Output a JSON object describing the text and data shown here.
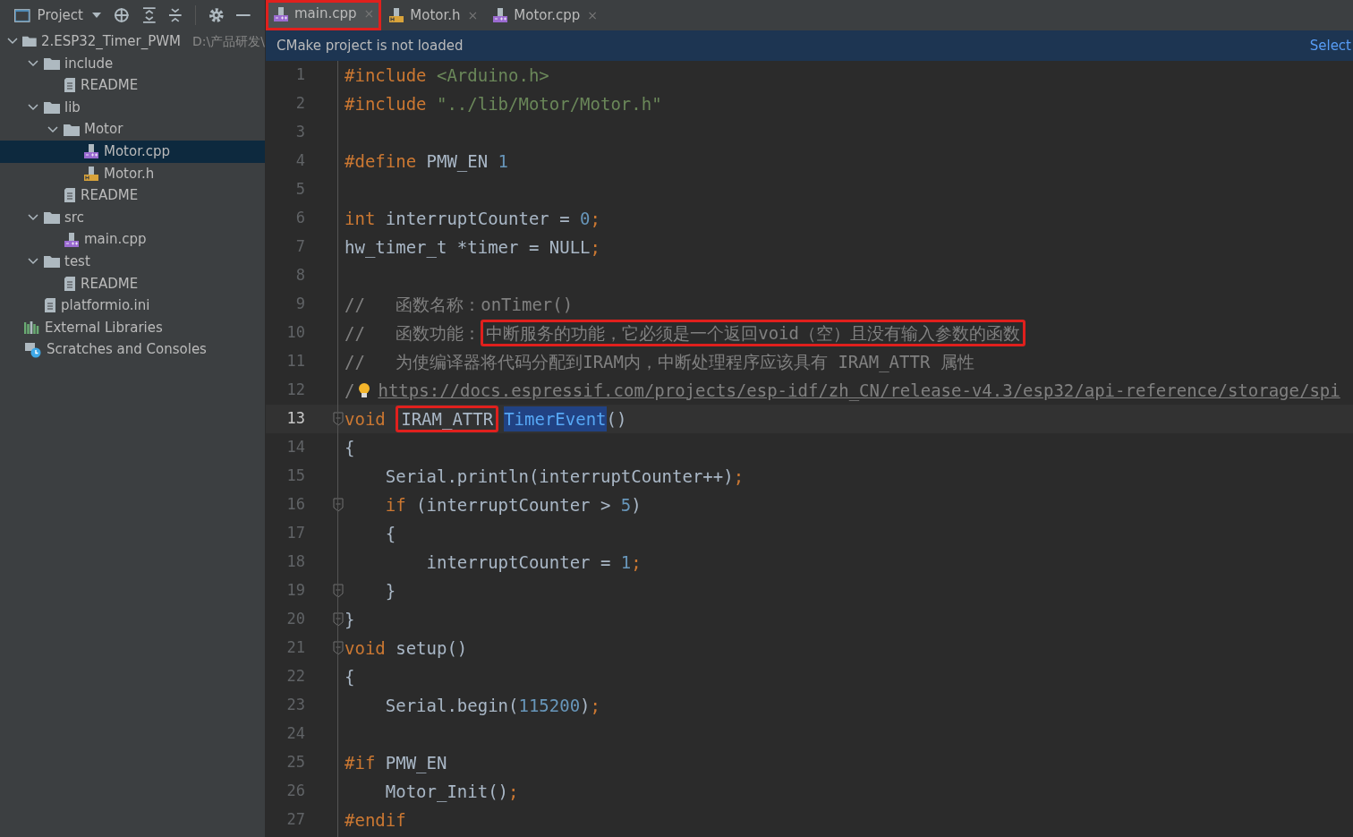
{
  "toolbar": {
    "title": "Project"
  },
  "tabs": [
    {
      "label": "main.cpp",
      "kind": "cpp",
      "selected": true,
      "boxed": true,
      "close": "×"
    },
    {
      "label": "Motor.h",
      "kind": "h",
      "selected": false,
      "boxed": false,
      "close": "×"
    },
    {
      "label": "Motor.cpp",
      "kind": "cpp",
      "selected": false,
      "boxed": false,
      "close": "×"
    }
  ],
  "banner": {
    "message": "CMake project is not loaded",
    "action": "Select"
  },
  "tree": [
    {
      "label": "2.ESP32_Timer_PWM",
      "path": "D:\\产品研发\\",
      "kind": "folder",
      "expanded": true,
      "selected": false,
      "children": [
        {
          "label": "include",
          "kind": "folder",
          "expanded": true,
          "selected": false,
          "children": [
            {
              "label": "README",
              "kind": "text",
              "selected": false
            }
          ]
        },
        {
          "label": "lib",
          "kind": "folder",
          "expanded": true,
          "selected": false,
          "children": [
            {
              "label": "Motor",
              "kind": "folder",
              "expanded": true,
              "selected": false,
              "children": [
                {
                  "label": "Motor.cpp",
                  "kind": "cpp",
                  "selected": true
                },
                {
                  "label": "Motor.h",
                  "kind": "h",
                  "selected": false
                }
              ]
            },
            {
              "label": "README",
              "kind": "text",
              "selected": false
            }
          ]
        },
        {
          "label": "src",
          "kind": "folder",
          "expanded": true,
          "selected": false,
          "children": [
            {
              "label": "main.cpp",
              "kind": "cpp",
              "selected": false
            }
          ]
        },
        {
          "label": "test",
          "kind": "folder",
          "expanded": true,
          "selected": false,
          "children": [
            {
              "label": "README",
              "kind": "text",
              "selected": false
            }
          ]
        },
        {
          "label": "platformio.ini",
          "kind": "text",
          "selected": false
        }
      ]
    },
    {
      "label": "External Libraries",
      "kind": "libraries",
      "selected": false
    },
    {
      "label": "Scratches and Consoles",
      "kind": "scratches",
      "selected": false
    }
  ],
  "code": [
    {
      "n": "1",
      "current": false,
      "tokens": [
        {
          "kind": "keyword",
          "text": "#include"
        },
        {
          "kind": "string",
          "text": " <Arduino.h>"
        }
      ]
    },
    {
      "n": "2",
      "current": false,
      "tokens": [
        {
          "kind": "keyword",
          "text": "#include"
        },
        {
          "kind": "string",
          "text": " \"../lib/Motor/Motor.h\""
        }
      ]
    },
    {
      "n": "3",
      "current": false
    },
    {
      "n": "4",
      "current": false,
      "tokens": [
        {
          "kind": "keyword",
          "text": "#define"
        },
        {
          "kind": "plain",
          "text": " PMW_EN "
        },
        {
          "kind": "number",
          "text": "1"
        }
      ]
    },
    {
      "n": "5",
      "current": false
    },
    {
      "n": "6",
      "current": false,
      "tokens": [
        {
          "kind": "keyword",
          "text": "int"
        },
        {
          "kind": "plain",
          "text": " interruptCounter = "
        },
        {
          "kind": "number",
          "text": "0"
        },
        {
          "kind": "keyword",
          "text": ";"
        }
      ]
    },
    {
      "n": "7",
      "current": false,
      "tokens": [
        {
          "kind": "plain",
          "text": "hw_timer_t *timer = NULL"
        },
        {
          "kind": "keyword",
          "text": ";"
        }
      ]
    },
    {
      "n": "8",
      "current": false
    },
    {
      "n": "9",
      "current": false,
      "tokens": [
        {
          "kind": "comment",
          "text": "//   函数名称：onTimer()"
        }
      ]
    },
    {
      "n": "10",
      "current": false,
      "tokens": [
        {
          "kind": "comment",
          "text": "//   函数功能："
        },
        {
          "kind": "comment",
          "text": "中断服务的功能，它必须是一个返回void（空）且没有输入参数的函数",
          "boxed": true
        }
      ]
    },
    {
      "n": "11",
      "current": false,
      "tokens": [
        {
          "kind": "comment",
          "text": "//   为使编译器将代码分配到IRAM内，中断处理程序应该具有 IRAM_ATTR 属性"
        }
      ]
    },
    {
      "n": "12",
      "current": false,
      "bulb": true,
      "tokens": [
        {
          "kind": "comment",
          "text": "/"
        },
        {
          "kind": "link",
          "text": "https://docs.espressif.com/projects/esp-idf/zh_CN/release-v4.3/esp32/api-reference/storage/spi"
        }
      ]
    },
    {
      "n": "13",
      "current": true,
      "fold": true,
      "tokens": [
        {
          "kind": "keyword",
          "text": "void "
        },
        {
          "kind": "plain",
          "text": "IRAM_ATTR",
          "boxed": true
        },
        {
          "kind": "function",
          "text": "TimerEvent",
          "selected": true
        },
        {
          "kind": "plain",
          "text": "()"
        }
      ]
    },
    {
      "n": "14",
      "current": false,
      "tokens": [
        {
          "kind": "plain",
          "text": "{"
        }
      ]
    },
    {
      "n": "15",
      "current": false,
      "tokens": [
        {
          "kind": "plain",
          "text": "    Serial.println(interruptCounter++)"
        },
        {
          "kind": "keyword",
          "text": ";"
        }
      ]
    },
    {
      "n": "16",
      "current": false,
      "fold": true,
      "tokens": [
        {
          "kind": "keyword",
          "text": "    if"
        },
        {
          "kind": "plain",
          "text": " (interruptCounter > "
        },
        {
          "kind": "number",
          "text": "5"
        },
        {
          "kind": "plain",
          "text": ")"
        }
      ]
    },
    {
      "n": "17",
      "current": false,
      "tokens": [
        {
          "kind": "plain",
          "text": "    {"
        }
      ]
    },
    {
      "n": "18",
      "current": false,
      "tokens": [
        {
          "kind": "plain",
          "text": "        interruptCounter = "
        },
        {
          "kind": "number",
          "text": "1"
        },
        {
          "kind": "keyword",
          "text": ";"
        }
      ]
    },
    {
      "n": "19",
      "current": false,
      "fold": true,
      "tokens": [
        {
          "kind": "plain",
          "text": "    }"
        }
      ]
    },
    {
      "n": "20",
      "current": false,
      "fold": true,
      "tokens": [
        {
          "kind": "plain",
          "text": "}"
        }
      ]
    },
    {
      "n": "21",
      "current": false,
      "fold": true,
      "tokens": [
        {
          "kind": "keyword",
          "text": "void"
        },
        {
          "kind": "plain",
          "text": " setup()"
        }
      ]
    },
    {
      "n": "22",
      "current": false,
      "tokens": [
        {
          "kind": "plain",
          "text": "{"
        }
      ]
    },
    {
      "n": "23",
      "current": false,
      "tokens": [
        {
          "kind": "plain",
          "text": "    Serial.begin("
        },
        {
          "kind": "number",
          "text": "115200"
        },
        {
          "kind": "plain",
          "text": ")"
        },
        {
          "kind": "keyword",
          "text": ";"
        }
      ]
    },
    {
      "n": "24",
      "current": false
    },
    {
      "n": "25",
      "current": false,
      "tokens": [
        {
          "kind": "keyword",
          "text": "#if"
        },
        {
          "kind": "plain",
          "text": " PMW_EN"
        }
      ]
    },
    {
      "n": "26",
      "current": false,
      "tokens": [
        {
          "kind": "plain",
          "text": "    Motor_Init()"
        },
        {
          "kind": "keyword",
          "text": ";"
        }
      ]
    },
    {
      "n": "27",
      "current": false,
      "tokens": [
        {
          "kind": "keyword",
          "text": "#endif"
        }
      ]
    }
  ]
}
